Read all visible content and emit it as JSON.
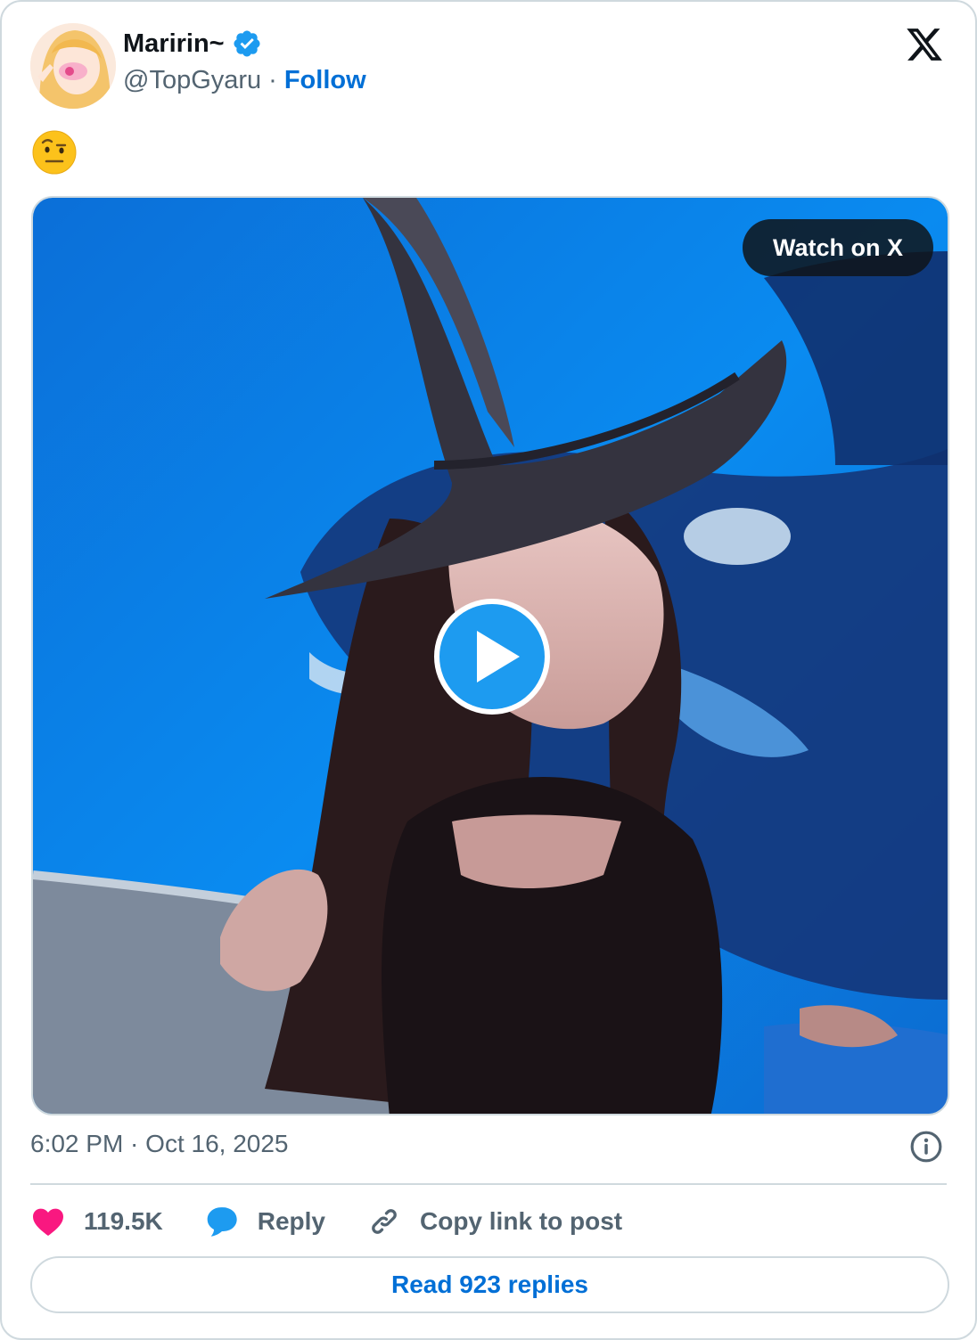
{
  "author": {
    "display_name": "Maririn~",
    "handle": "@TopGyaru",
    "separator": "·",
    "follow_label": "Follow",
    "verified": true
  },
  "tweet": {
    "emoji": "face-with-raised-eyebrow"
  },
  "media": {
    "watch_label": "Watch on X"
  },
  "meta": {
    "timestamp": "6:02 PM · Oct 16, 2025"
  },
  "actions": {
    "likes": "119.5K",
    "reply_label": "Reply",
    "copy_label": "Copy link to post",
    "read_replies_label": "Read 923 replies"
  },
  "colors": {
    "accent": "#1d9bf0",
    "link": "#006fd6",
    "like": "#f91880",
    "muted": "#536471",
    "border": "#cfd9de"
  }
}
